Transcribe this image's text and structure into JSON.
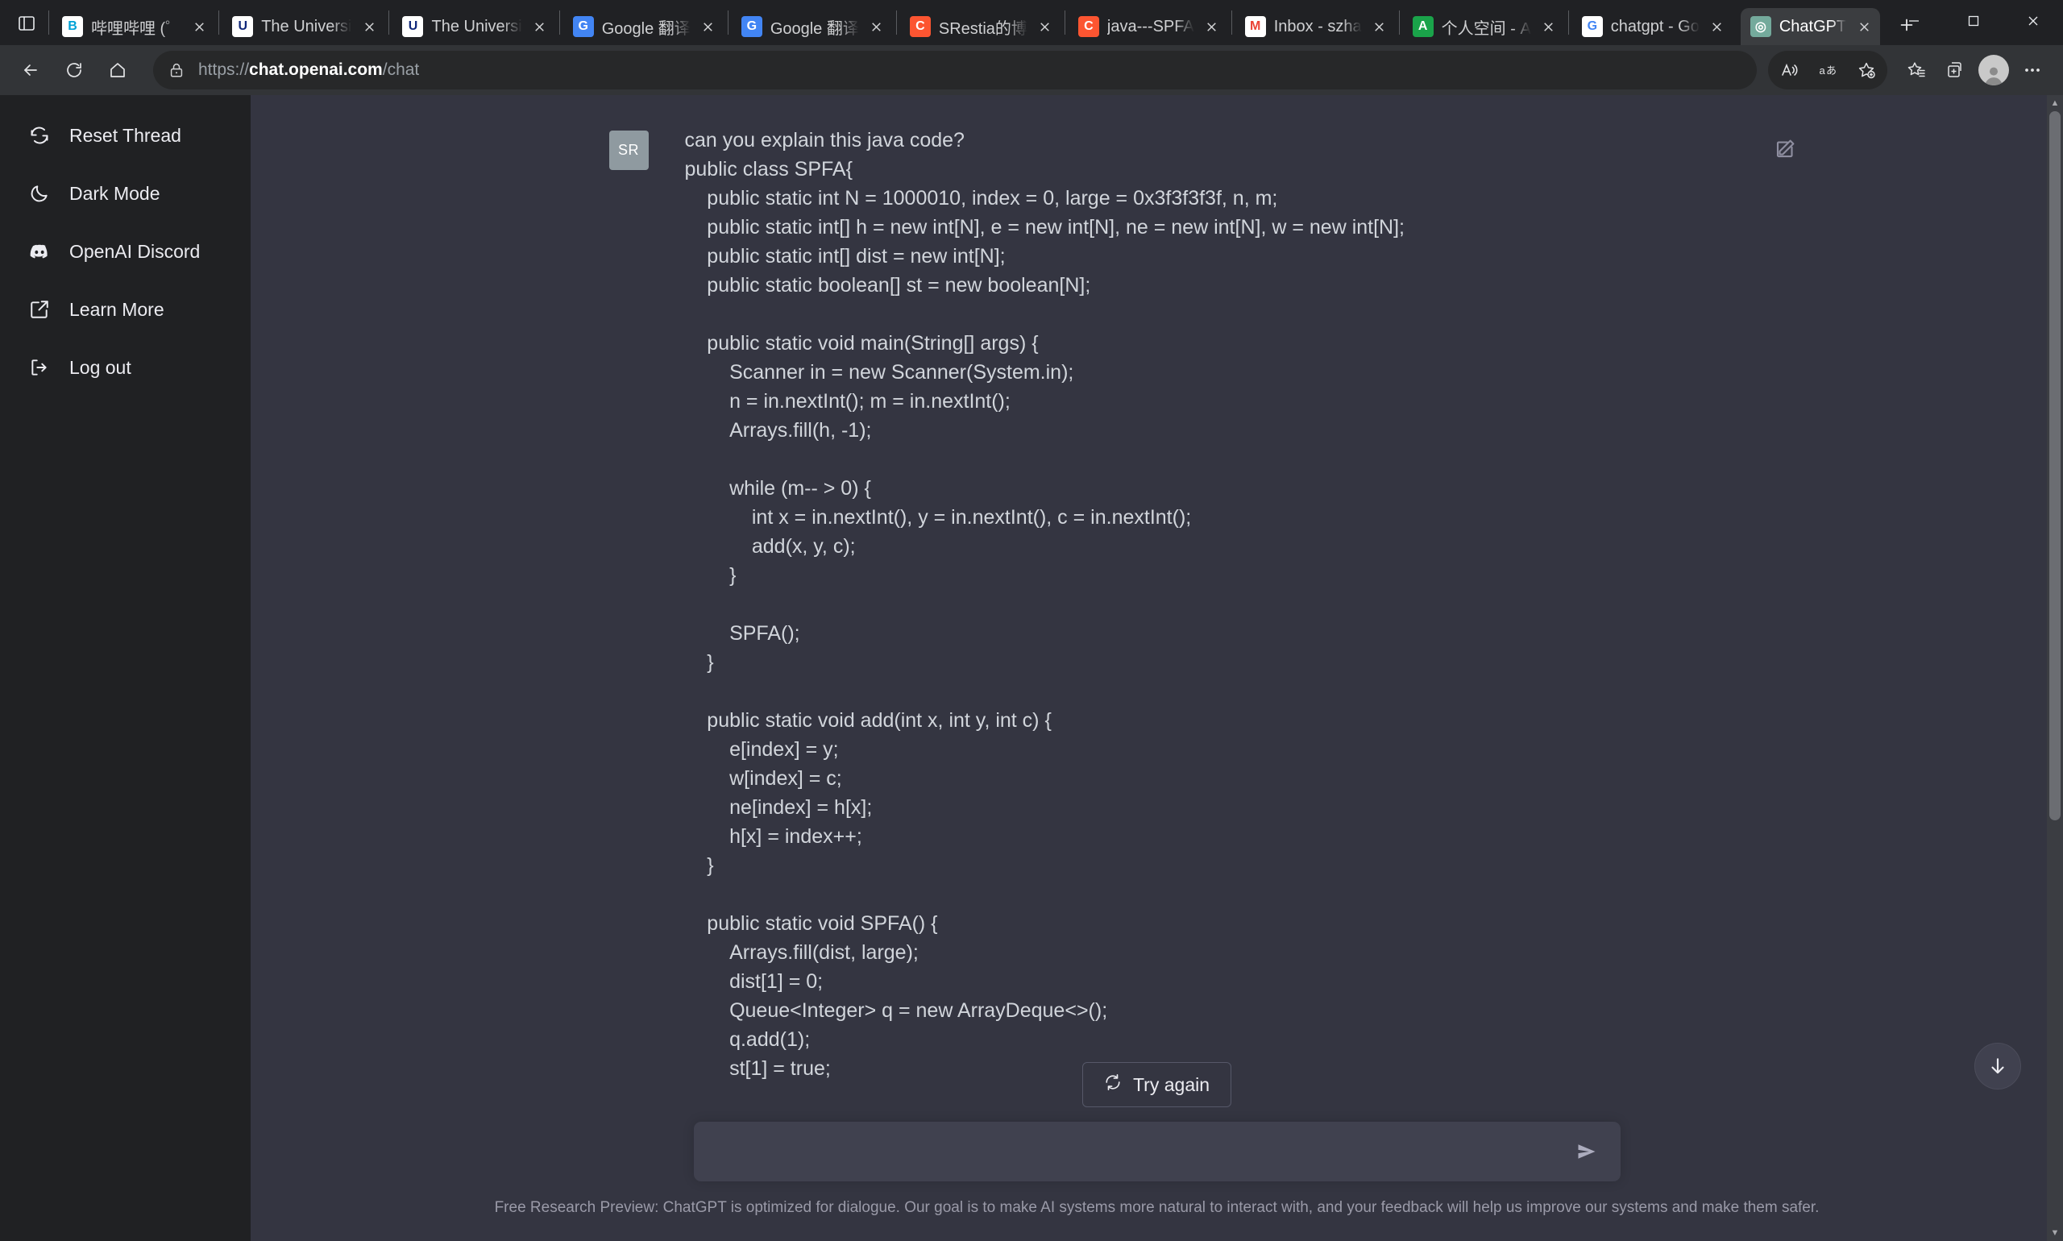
{
  "browser": {
    "tabs": [
      {
        "title": "哔哩哔哩 (゜",
        "favicon": "bilibili-icon",
        "fav_text": "B",
        "fav_bg": "#ffffff",
        "fav_fg": "#00a1d6",
        "active": false
      },
      {
        "title": "The Universi",
        "favicon": "university-crest-icon",
        "fav_text": "U",
        "fav_bg": "#ffffff",
        "fav_fg": "#10277a",
        "active": false
      },
      {
        "title": "The Universi",
        "favicon": "university-crest-icon",
        "fav_text": "U",
        "fav_bg": "#ffffff",
        "fav_fg": "#10277a",
        "active": false
      },
      {
        "title": "Google 翻译",
        "favicon": "google-translate-icon",
        "fav_text": "G",
        "fav_bg": "#4285f4",
        "fav_fg": "#ffffff",
        "active": false
      },
      {
        "title": "Google 翻译",
        "favicon": "google-translate-icon",
        "fav_text": "G",
        "fav_bg": "#4285f4",
        "fav_fg": "#ffffff",
        "active": false
      },
      {
        "title": "SRestia的博",
        "favicon": "csdn-icon",
        "fav_text": "C",
        "fav_bg": "#fc5531",
        "fav_fg": "#ffffff",
        "active": false
      },
      {
        "title": "java---SPFA",
        "favicon": "csdn-icon",
        "fav_text": "C",
        "fav_bg": "#fc5531",
        "fav_fg": "#ffffff",
        "active": false
      },
      {
        "title": "Inbox - szha",
        "favicon": "gmail-icon",
        "fav_text": "M",
        "fav_bg": "#ffffff",
        "fav_fg": "#ea4335",
        "active": false
      },
      {
        "title": "个人空间 - A",
        "favicon": "acwing-icon",
        "fav_text": "A",
        "fav_bg": "#1aa34a",
        "fav_fg": "#ffffff",
        "active": false
      },
      {
        "title": "chatgpt - Go",
        "favicon": "google-icon",
        "fav_text": "G",
        "fav_bg": "#ffffff",
        "fav_fg": "#4285f4",
        "active": false
      },
      {
        "title": "ChatGPT",
        "favicon": "openai-icon",
        "fav_text": "◎",
        "fav_bg": "#74aa9c",
        "fav_fg": "#ffffff",
        "active": true
      }
    ],
    "tab_actions": {
      "tab_search_label": "tab-actions-menu",
      "new_tab_label": "New tab"
    },
    "window_controls": {
      "minimize": "Minimize",
      "maximize": "Maximize",
      "close": "Close"
    },
    "nav": {
      "back": "Back",
      "refresh": "Refresh",
      "home": "Home",
      "read_aloud": "Read aloud",
      "translate": "Translate",
      "add_favorite": "Add this page to favorites",
      "favorites": "Favorites",
      "collections": "Collections",
      "profile": "Profile",
      "settings_more": "Settings and more"
    },
    "address": {
      "scheme": "https://",
      "host": "chat.openai.com",
      "path": "/chat",
      "full": "https://chat.openai.com/chat"
    }
  },
  "sidebar": {
    "items": [
      {
        "label": "Reset Thread",
        "icon": "reset-thread-icon"
      },
      {
        "label": "Dark Mode",
        "icon": "moon-icon"
      },
      {
        "label": "OpenAI Discord",
        "icon": "discord-icon"
      },
      {
        "label": "Learn More",
        "icon": "external-link-icon"
      },
      {
        "label": "Log out",
        "icon": "logout-icon"
      }
    ]
  },
  "chat": {
    "message": {
      "avatar_initials": "SR",
      "text": "can you explain this java code?\npublic class SPFA{\n    public static int N = 1000010, index = 0, large = 0x3f3f3f3f, n, m;\n    public static int[] h = new int[N], e = new int[N], ne = new int[N], w = new int[N];\n    public static int[] dist = new int[N];\n    public static boolean[] st = new boolean[N];\n\n    public static void main(String[] args) {\n        Scanner in = new Scanner(System.in);\n        n = in.nextInt(); m = in.nextInt();\n        Arrays.fill(h, -1);\n\n        while (m-- > 0) {\n            int x = in.nextInt(), y = in.nextInt(), c = in.nextInt();\n            add(x, y, c);\n        }\n\n        SPFA();\n    }\n\n    public static void add(int x, int y, int c) {\n        e[index] = y;\n        w[index] = c;\n        ne[index] = h[x];\n        h[x] = index++;\n    }\n\n    public static void SPFA() {\n        Arrays.fill(dist, large);\n        dist[1] = 0;\n        Queue<Integer> q = new ArrayDeque<>();\n        q.add(1);\n        st[1] = true;"
    },
    "edit_button_label": "edit-message",
    "try_again_label": "Try again",
    "try_again_icon": "refresh-icon",
    "scroll_to_bottom_label": "scroll-to-bottom",
    "composer": {
      "value": "",
      "placeholder": "",
      "send_label": "send-message"
    },
    "footer": "Free Research Preview: ChatGPT is optimized for dialogue. Our goal is to make AI systems more natural to interact with, and your feedback will help us improve our systems and make them safer."
  },
  "colors": {
    "page_bg": "#343541",
    "sidebar_bg": "#202123",
    "composer_bg": "#40414f",
    "accent": "#74aa9c",
    "chrome_bg": "#202124",
    "navbar_bg": "#323437"
  }
}
